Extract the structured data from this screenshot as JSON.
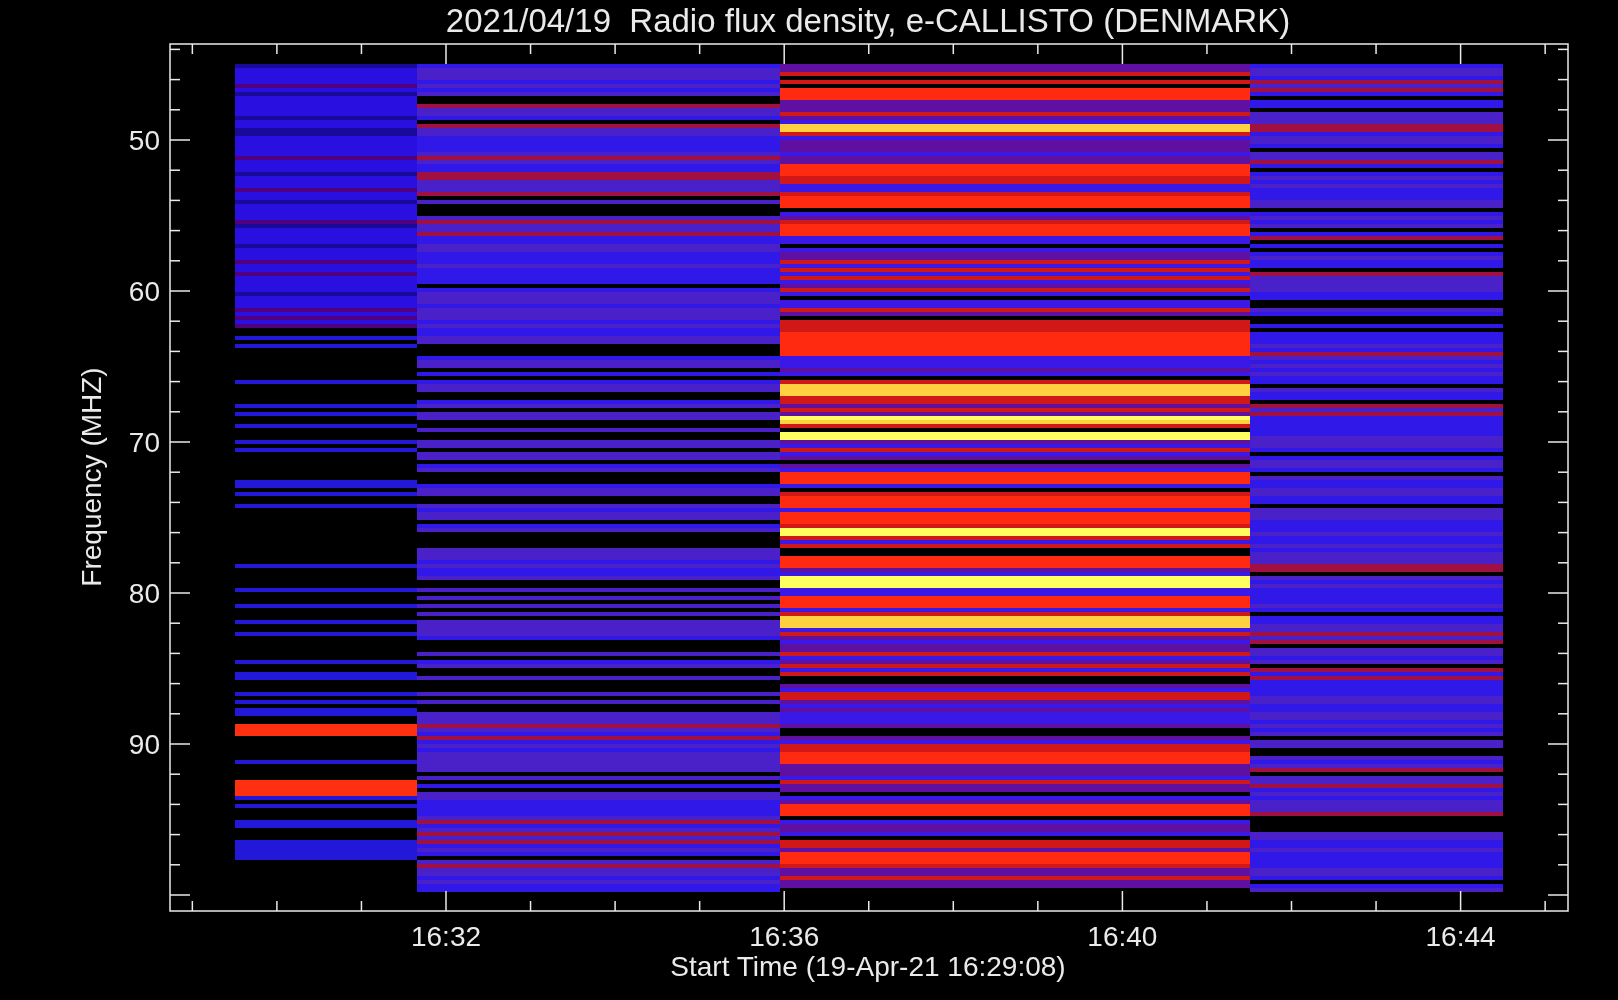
{
  "title": "2021/04/19  Radio flux density, e-CALLISTO (DENMARK)",
  "y_axis": {
    "label": "Frequency (MHZ)",
    "tick_labels": [
      "50",
      "60",
      "70",
      "80",
      "90"
    ]
  },
  "x_axis": {
    "label": "Start Time (19-Apr-21 16:29:08)",
    "tick_labels": [
      "16:32",
      "16:36",
      "16:40",
      "16:44"
    ]
  }
}
